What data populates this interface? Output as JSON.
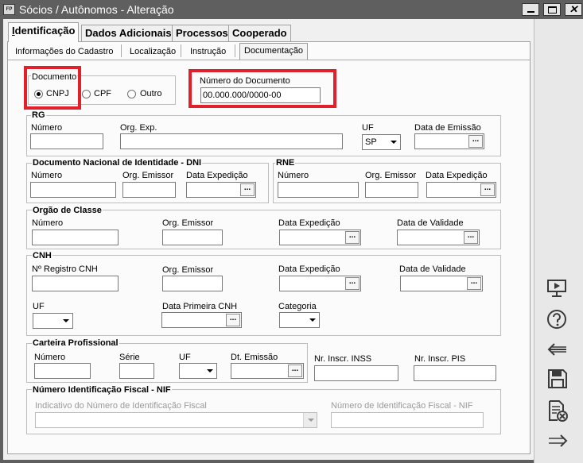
{
  "window": {
    "app_icon": "FP",
    "title": "Sócios / Autônomos - Alteração",
    "controls": [
      "minimize-icon",
      "maximize-icon",
      "close-icon"
    ],
    "close_glyph": "✕"
  },
  "tabs": [
    "Identificação",
    "Dados Adicionais",
    "Processos",
    "Cooperado"
  ],
  "active_tab": "Identificação",
  "subtabs": [
    "Informações do Cadastro",
    "Localização",
    "Instrução",
    "Documentação"
  ],
  "active_subtab": "Documentação",
  "documento": {
    "title": "Documento",
    "options": [
      "CNPJ",
      "CPF",
      "Outro"
    ],
    "selected": "CNPJ"
  },
  "numero_documento": {
    "label": "Número do Documento",
    "value": "00.000.000/0000-00"
  },
  "rg": {
    "title": "RG",
    "numero_label": "Número",
    "numero_value": "",
    "org_exp_label": "Org. Exp.",
    "org_exp_value": "",
    "uf_label": "UF",
    "uf_value": "SP",
    "data_emissao_label": "Data de Emissão",
    "data_emissao_value": ""
  },
  "dni": {
    "title": "Documento Nacional de Identidade - DNI",
    "numero_label": "Número",
    "org_emissor_label": "Org. Emissor",
    "data_expedicao_label": "Data Expedição"
  },
  "rne": {
    "title": "RNE",
    "numero_label": "Número",
    "org_emissor_label": "Org. Emissor",
    "data_expedicao_label": "Data Expedição"
  },
  "orgao_classe": {
    "title": "Orgão de Classe",
    "numero_label": "Número",
    "org_emissor_label": "Org. Emissor",
    "data_expedicao_label": "Data Expedição",
    "data_validade_label": "Data de Validade"
  },
  "cnh": {
    "title": "CNH",
    "registro_label": "Nº Registro CNH",
    "org_emissor_label": "Org. Emissor",
    "data_expedicao_label": "Data Expedição",
    "data_validade_label": "Data de Validade",
    "uf_label": "UF",
    "uf_value": "",
    "primeira_label": "Data Primeira CNH",
    "categoria_label": "Categoria",
    "categoria_value": ""
  },
  "carteira": {
    "title": "Carteira Profissional",
    "numero_label": "Número",
    "serie_label": "Série",
    "uf_label": "UF",
    "uf_value": "",
    "dt_emissao_label": "Dt. Emissão"
  },
  "inss": {
    "label": "Nr. Inscr. INSS",
    "value": ""
  },
  "pis": {
    "label": "Nr. Inscr. PIS",
    "value": ""
  },
  "nif": {
    "title": "Número Identificação Fiscal - NIF",
    "indicativo_label": "Indicativo do Número de Identificação Fiscal",
    "indicativo_value": "",
    "numero_label": "Número de Identificação Fiscal - NIF",
    "numero_value": ""
  },
  "date_button_glyph": "...",
  "toolbar": [
    "presentation-icon",
    "help-icon",
    "back-arrow-icon",
    "save-icon",
    "cancel-document-icon",
    "forward-arrow-icon"
  ],
  "colors": {
    "titlebar": "#5f5f5f",
    "highlight": "#e2202a",
    "panel": "#fbfbfb",
    "toolbar": "#e8e8e8"
  }
}
